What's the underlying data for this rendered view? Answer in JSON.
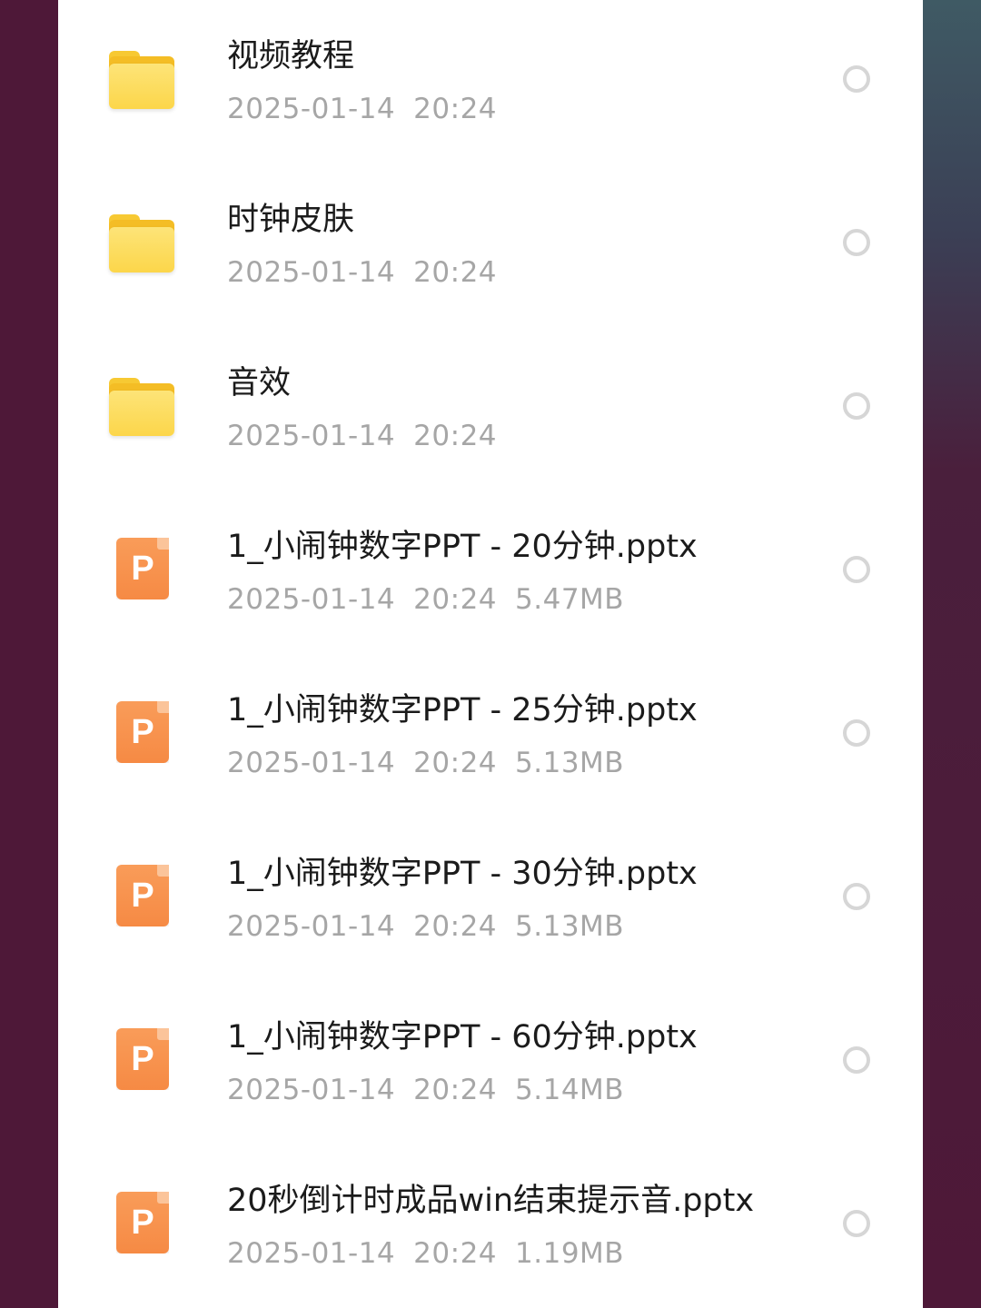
{
  "colors": {
    "page_background": "#4e1838",
    "panel_background": "#ffffff",
    "name_text": "#1b1b1b",
    "meta_text": "#a6a6a6",
    "folder": "#fcd64a",
    "ppt": "#f68a44",
    "checkbox_border": "#d6d6d6"
  },
  "files": [
    {
      "type": "folder",
      "icon": "folder-icon",
      "name": "视频教程",
      "date": "2025-01-14",
      "time": "20:24",
      "size": ""
    },
    {
      "type": "folder",
      "icon": "folder-icon",
      "name": "时钟皮肤",
      "date": "2025-01-14",
      "time": "20:24",
      "size": ""
    },
    {
      "type": "folder",
      "icon": "folder-icon",
      "name": "音效",
      "date": "2025-01-14",
      "time": "20:24",
      "size": ""
    },
    {
      "type": "pptx",
      "icon": "pptx-file-icon",
      "icon_letter": "P",
      "name": "1_小闹钟数字PPT - 20分钟.pptx",
      "date": "2025-01-14",
      "time": "20:24",
      "size": "5.47MB"
    },
    {
      "type": "pptx",
      "icon": "pptx-file-icon",
      "icon_letter": "P",
      "name": "1_小闹钟数字PPT - 25分钟.pptx",
      "date": "2025-01-14",
      "time": "20:24",
      "size": "5.13MB"
    },
    {
      "type": "pptx",
      "icon": "pptx-file-icon",
      "icon_letter": "P",
      "name": "1_小闹钟数字PPT - 30分钟.pptx",
      "date": "2025-01-14",
      "time": "20:24",
      "size": "5.13MB"
    },
    {
      "type": "pptx",
      "icon": "pptx-file-icon",
      "icon_letter": "P",
      "name": "1_小闹钟数字PPT - 60分钟.pptx",
      "date": "2025-01-14",
      "time": "20:24",
      "size": "5.14MB"
    },
    {
      "type": "pptx",
      "icon": "pptx-file-icon",
      "icon_letter": "P",
      "name": "20秒倒计时成品win结束提示音.pptx",
      "date": "2025-01-14",
      "time": "20:24",
      "size": "1.19MB"
    }
  ]
}
